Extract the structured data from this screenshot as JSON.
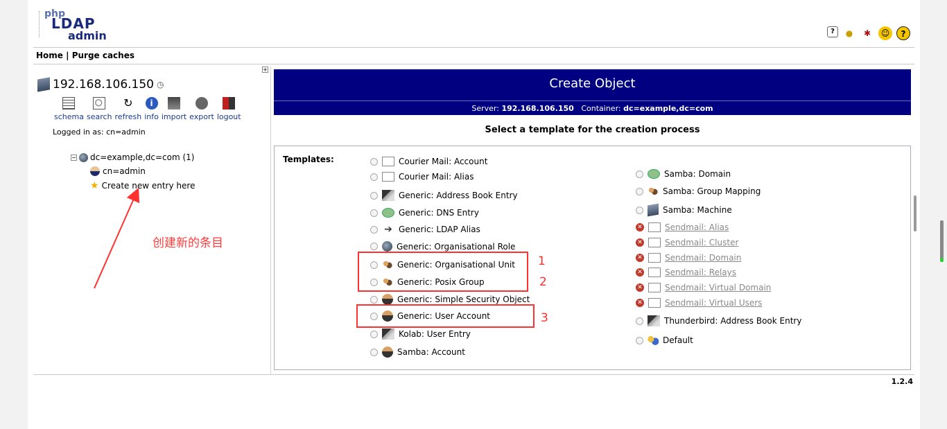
{
  "header": {
    "logo": {
      "php": "php",
      "ldap": "LDAP",
      "admin": "admin"
    },
    "nav": {
      "home": "Home",
      "sep": " | ",
      "purge": "Purge caches"
    },
    "icons": [
      "help-icon",
      "hint-icon",
      "bug-icon",
      "smile-icon",
      "support-icon"
    ]
  },
  "left": {
    "server": "192.168.106.150",
    "toolbar": [
      "schema",
      "search",
      "refresh",
      "info",
      "import",
      "export",
      "logout"
    ],
    "logged_in": "Logged in as: cn=admin",
    "tree": {
      "root": "dc=example,dc=com (1)",
      "child": "cn=admin",
      "create": "Create new entry here"
    },
    "annotation": "创建新的条目"
  },
  "main": {
    "title": "Create Object",
    "server_label": "Server:",
    "server_value": "192.168.106.150",
    "container_label": "Container:",
    "container_value": "dc=example,dc=com",
    "select_header": "Select a template for the creation process",
    "templates_label": "Templates:",
    "left_templates": [
      "Courier Mail: Account",
      "Courier Mail: Alias",
      "Generic: Address Book Entry",
      "Generic: DNS Entry",
      "Generic: LDAP Alias",
      "Generic: Organisational Role",
      "Generic: Organisational Unit",
      "Generic: Posix Group",
      "Generic: Simple Security Object",
      "Generic: User Account",
      "Kolab: User Entry",
      "Samba: Account"
    ],
    "right_templates": [
      "Samba: Domain",
      "Samba: Group Mapping",
      "Samba: Machine",
      "Sendmail: Alias",
      "Sendmail: Cluster",
      "Sendmail: Domain",
      "Sendmail: Relays",
      "Sendmail: Virtual Domain",
      "Sendmail: Virtual Users",
      "Thunderbird: Address Book Entry",
      "Default"
    ],
    "markers": [
      "1",
      "2",
      "3"
    ]
  },
  "footer": {
    "version": "1.2.4"
  }
}
